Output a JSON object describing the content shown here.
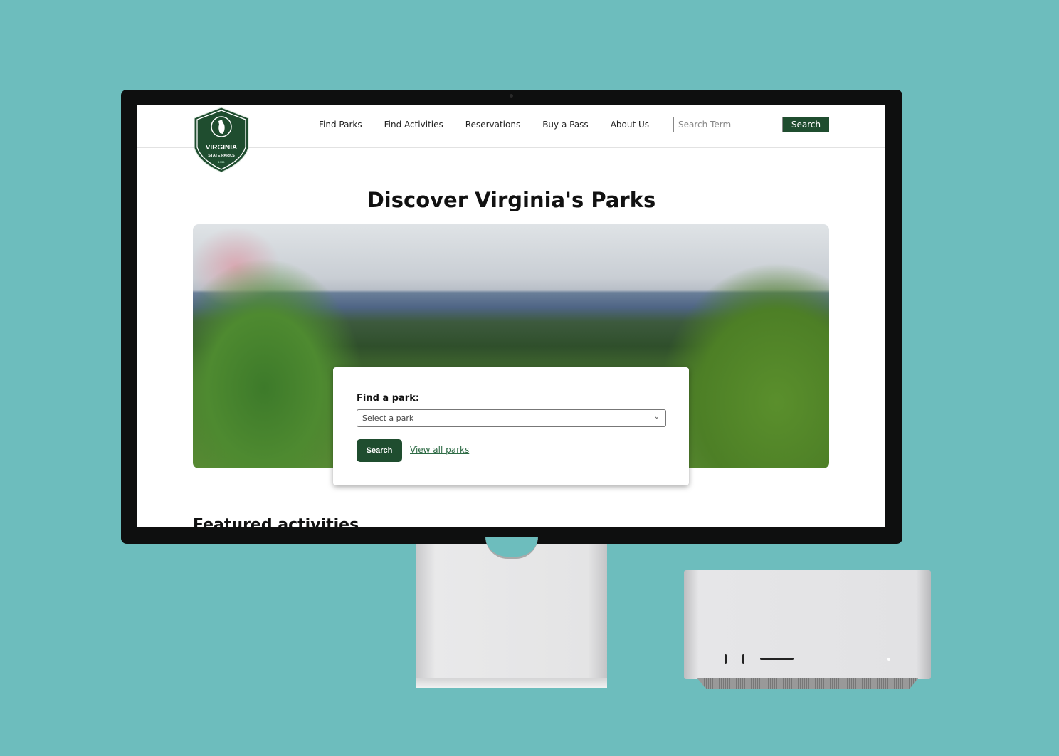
{
  "site": {
    "logo": {
      "text": "VIRGINIA",
      "subtext": "STATE PARKS",
      "year": "1936"
    },
    "nav": [
      "Find Parks",
      "Find Activities",
      "Reservations",
      "Buy a Pass",
      "About Us"
    ],
    "search": {
      "placeholder": "Search Term",
      "button": "Search"
    },
    "title": "Discover Virginia's Parks",
    "finder": {
      "label": "Find a park:",
      "select_value": "Select a park",
      "button": "Search",
      "link": "View all parks"
    },
    "featured_heading": "Featured activities"
  },
  "colors": {
    "brand_green": "#1f4d2f",
    "background": "#6dbdbd"
  }
}
